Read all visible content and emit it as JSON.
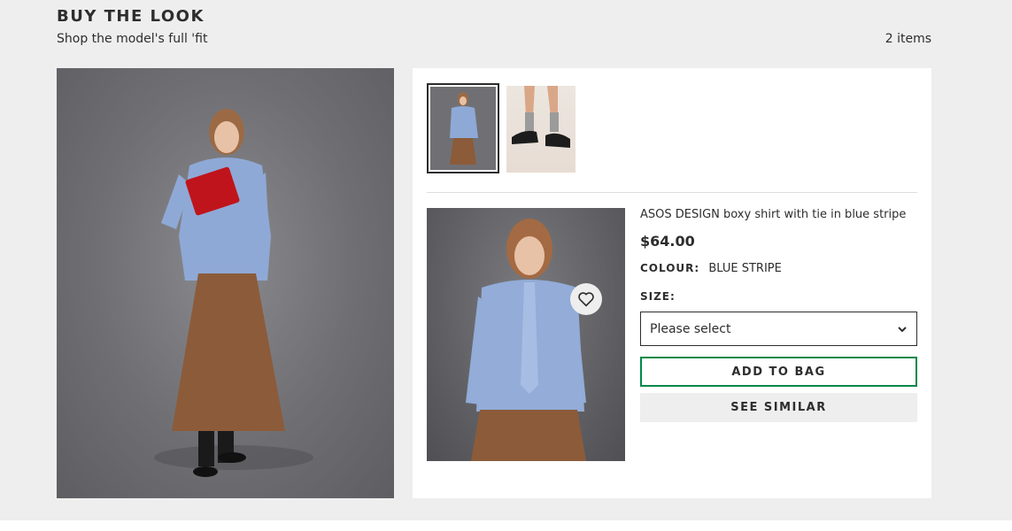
{
  "section": {
    "title": "BUY THE LOOK",
    "subtitle": "Shop the model's full 'fit",
    "item_count": "2 items"
  },
  "model_image": {
    "alt": "Model wearing blue stripe shirt, brown pleated skirt and holding red clutch"
  },
  "thumbnails": [
    {
      "name": "shirt-thumbnail",
      "selected": true
    },
    {
      "name": "shoes-thumbnail",
      "selected": false
    }
  ],
  "product": {
    "name": "ASOS DESIGN boxy shirt with tie in blue stripe",
    "price": "$64.00",
    "colour_label": "COLOUR:",
    "colour_value": "BLUE STRIPE",
    "size_label": "SIZE:",
    "size_select_value": "Please select",
    "add_to_bag_label": "ADD TO BAG",
    "see_similar_label": "SEE SIMILAR"
  },
  "colors": {
    "accent_green": "#018849",
    "text": "#2d2d2d",
    "background": "#eeeeee"
  },
  "icons": {
    "wishlist": "heart-icon",
    "select": "chevron-down-icon"
  }
}
